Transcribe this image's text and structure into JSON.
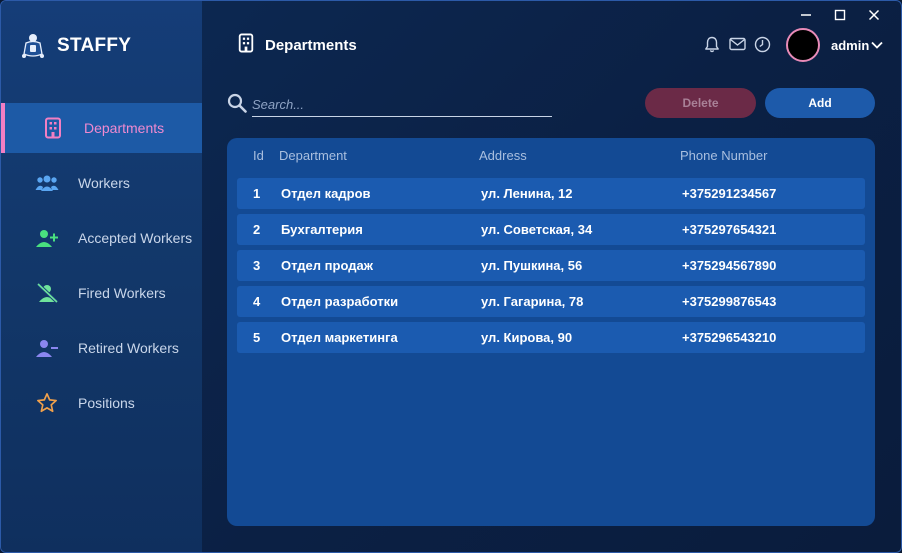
{
  "app": {
    "name": "STAFFY"
  },
  "header": {
    "title": "Departments"
  },
  "user": {
    "name": "admin"
  },
  "sidebar": {
    "items": [
      {
        "label": "Departments",
        "icon": "building-icon",
        "active": true
      },
      {
        "label": "Workers",
        "icon": "users-icon"
      },
      {
        "label": "Accepted Workers",
        "icon": "user-plus-icon"
      },
      {
        "label": "Fired Workers",
        "icon": "user-slash-icon"
      },
      {
        "label": "Retired Workers",
        "icon": "user-minus-icon"
      },
      {
        "label": "Positions",
        "icon": "star-icon"
      }
    ]
  },
  "search": {
    "placeholder": "Search...",
    "value": ""
  },
  "toolbar": {
    "delete_label": "Delete",
    "add_label": "Add"
  },
  "table": {
    "columns": [
      "Id",
      "Department",
      "Address",
      "Phone Number"
    ],
    "rows": [
      {
        "id": "1",
        "department": "Отдел кадров",
        "address": "ул. Ленина, 12",
        "phone": "+375291234567"
      },
      {
        "id": "2",
        "department": "Бухгалтерия",
        "address": "ул. Советская, 34",
        "phone": "+375297654321"
      },
      {
        "id": "3",
        "department": "Отдел продаж",
        "address": "ул. Пушкина, 56",
        "phone": "+375294567890"
      },
      {
        "id": "4",
        "department": "Отдел разработки",
        "address": "ул. Гагарина, 78",
        "phone": "+375299876543"
      },
      {
        "id": "5",
        "department": "Отдел маркетинга",
        "address": "ул. Кирова, 90",
        "phone": "+375296543210"
      }
    ]
  },
  "colors": {
    "accent_pink": "#f27fc3",
    "active_bg": "#1d5aa6",
    "panel_bg": "#134a94",
    "row_bg": "#1b5bb0",
    "delete_bg": "#6b2a47",
    "add_bg": "#1d5aaa"
  }
}
